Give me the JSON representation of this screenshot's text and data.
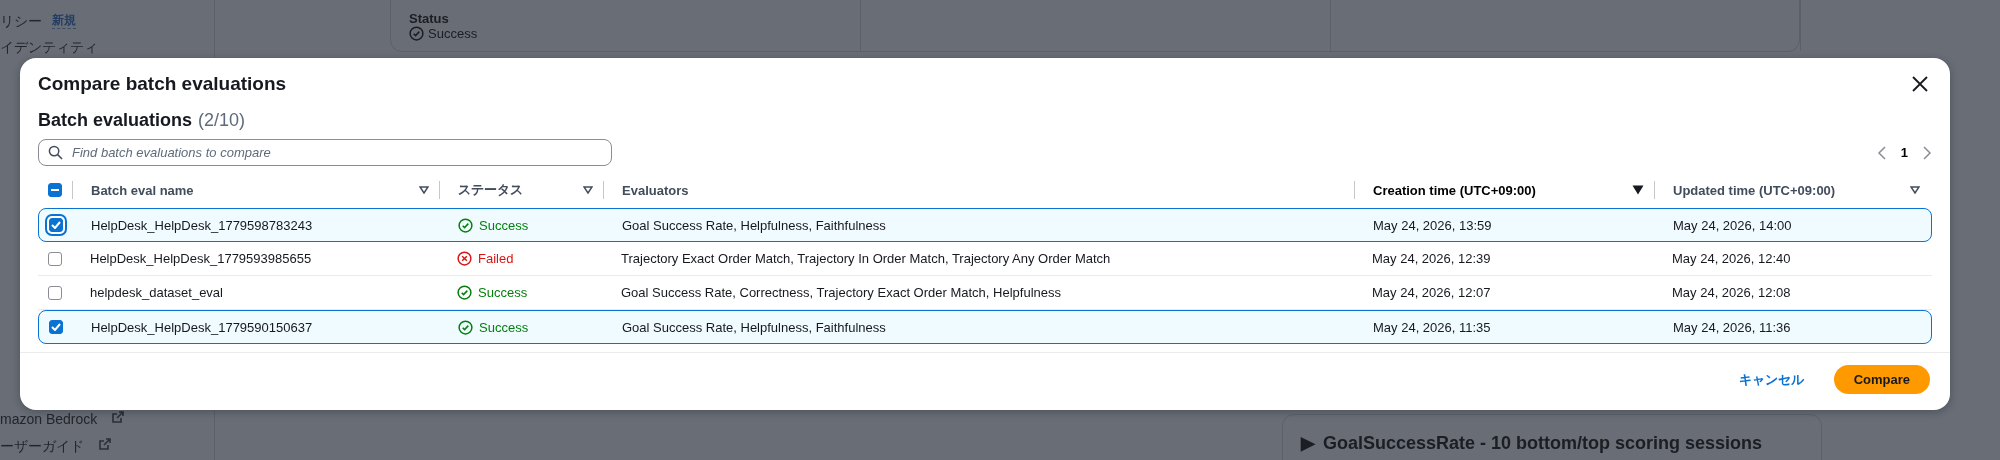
{
  "sidebar": {
    "top_items": [
      {
        "label": "リシー",
        "badge": "新規"
      },
      {
        "label": "イデンティティ"
      }
    ],
    "bottom_items": [
      {
        "label": "mazon Bedrock",
        "external": true
      },
      {
        "label": "ーザーガイド",
        "external": true
      }
    ]
  },
  "summary_card": {
    "label": "Status",
    "value": "Success"
  },
  "collapsed_section": {
    "expander": "▶",
    "title": "GoalSuccessRate - 10 bottom/top scoring sessions"
  },
  "modal": {
    "title": "Compare batch evaluations",
    "heading": "Batch evaluations",
    "count": "(2/10)",
    "search": {
      "placeholder": "Find batch evaluations to compare"
    },
    "pagination": {
      "page": "1"
    },
    "select_all": {
      "indeterminate": true
    },
    "columns": [
      {
        "label": "Batch eval name",
        "sortable": true,
        "sorted": false
      },
      {
        "label": "ステータス",
        "sortable": true,
        "sorted": false
      },
      {
        "label": "Evaluators",
        "sortable": false
      },
      {
        "label": "Creation time (UTC+09:00)",
        "sortable": true,
        "sorted": true
      },
      {
        "label": "Updated time (UTC+09:00)",
        "sortable": true,
        "sorted": false
      }
    ],
    "rows": [
      {
        "selected": true,
        "name": "HelpDesk_HelpDesk_1779598783243",
        "status": {
          "kind": "success",
          "label": "Success"
        },
        "evaluators": "Goal Success Rate, Helpfulness, Faithfulness",
        "created": "May 24, 2026, 13:59",
        "updated": "May 24, 2026, 14:00"
      },
      {
        "selected": false,
        "name": "HelpDesk_HelpDesk_1779593985655",
        "status": {
          "kind": "failed",
          "label": "Failed"
        },
        "evaluators": "Trajectory Exact Order Match, Trajectory In Order Match, Trajectory Any Order Match",
        "created": "May 24, 2026, 12:39",
        "updated": "May 24, 2026, 12:40"
      },
      {
        "selected": false,
        "name": "helpdesk_dataset_eval",
        "status": {
          "kind": "success",
          "label": "Success"
        },
        "evaluators": "Goal Success Rate, Correctness, Trajectory Exact Order Match, Helpfulness",
        "created": "May 24, 2026, 12:07",
        "updated": "May 24, 2026, 12:08"
      },
      {
        "selected": true,
        "name": "HelpDesk_HelpDesk_1779590150637",
        "status": {
          "kind": "success",
          "label": "Success"
        },
        "evaluators": "Goal Success Rate, Helpfulness, Faithfulness",
        "created": "May 24, 2026, 11:35",
        "updated": "May 24, 2026, 11:36"
      }
    ],
    "buttons": {
      "cancel": "キャンセル",
      "confirm": "Compare"
    }
  }
}
